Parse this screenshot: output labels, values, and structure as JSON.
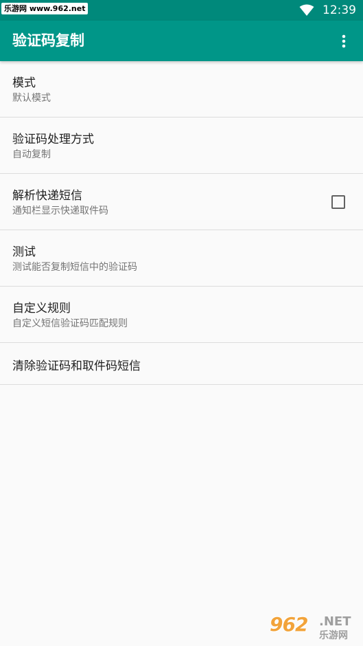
{
  "status_bar": {
    "watermark": "乐游网 www.962.net",
    "time": "12:39"
  },
  "app_bar": {
    "title": "验证码复制",
    "overflow_icon": "more-vert-icon"
  },
  "preferences": [
    {
      "title": "模式",
      "summary": "默认模式"
    },
    {
      "title": "验证码处理方式",
      "summary": "自动复制"
    },
    {
      "title": "解析快递短信",
      "summary": "通知栏显示快递取件码",
      "checkbox": false
    },
    {
      "title": "测试",
      "summary": "测试能否复制短信中的验证码"
    },
    {
      "title": "自定义规则",
      "summary": "自定义短信验证码匹配规则"
    },
    {
      "title": "清除验证码和取件码短信"
    }
  ],
  "watermark_bottom": {
    "number": "962",
    "suffix": ".NET",
    "cn": "乐游网"
  },
  "colors": {
    "status_bar": "#00897b",
    "app_bar": "#009688",
    "background": "#fafafa"
  }
}
